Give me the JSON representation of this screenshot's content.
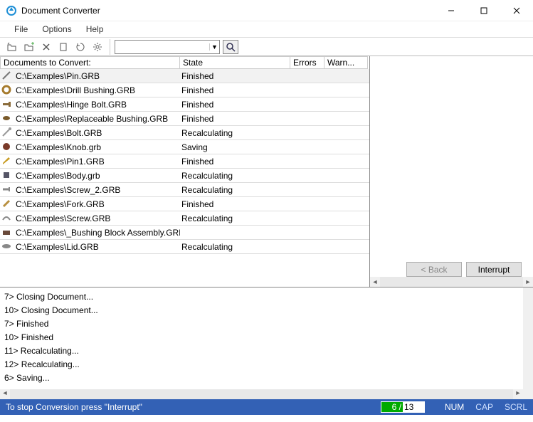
{
  "window": {
    "title": "Document Converter"
  },
  "menu": {
    "file": "File",
    "options": "Options",
    "help": "Help"
  },
  "toolbar": {
    "combo_value": ""
  },
  "grid": {
    "headers": {
      "documents": "Documents to Convert:",
      "state": "State",
      "errors": "Errors",
      "warnings": "Warn..."
    },
    "rows": [
      {
        "path": "C:\\Examples\\Pin.GRB",
        "state": "Finished",
        "icon": "pin",
        "selected": true
      },
      {
        "path": "C:\\Examples\\Drill Bushing.GRB",
        "state": "Finished",
        "icon": "ring"
      },
      {
        "path": "C:\\Examples\\Hinge Bolt.GRB",
        "state": "Finished",
        "icon": "bolt"
      },
      {
        "path": "C:\\Examples\\Replaceable Bushing.GRB",
        "state": "Finished",
        "icon": "bushing"
      },
      {
        "path": "C:\\Examples\\Bolt.GRB",
        "state": "Recalculating",
        "icon": "bolt2"
      },
      {
        "path": "C:\\Examples\\Knob.grb",
        "state": "Saving",
        "icon": "knob"
      },
      {
        "path": "C:\\Examples\\Pin1.GRB",
        "state": "Finished",
        "icon": "pin1"
      },
      {
        "path": "C:\\Examples\\Body.grb",
        "state": "Recalculating",
        "icon": "body"
      },
      {
        "path": "C:\\Examples\\Screw_2.GRB",
        "state": "Recalculating",
        "icon": "screw"
      },
      {
        "path": "C:\\Examples\\Fork.GRB",
        "state": "Finished",
        "icon": "fork"
      },
      {
        "path": "C:\\Examples\\Screw.GRB",
        "state": "Recalculating",
        "icon": "screw2"
      },
      {
        "path": "C:\\Examples\\_Bushing Block Assembly.GRB",
        "state": "",
        "icon": "asm"
      },
      {
        "path": "C:\\Examples\\Lid.GRB",
        "state": "Recalculating",
        "icon": "lid"
      }
    ]
  },
  "right": {
    "back": "< Back",
    "interrupt": "Interrupt"
  },
  "log": {
    "lines": [
      "7> Closing Document...",
      "10> Closing Document...",
      "7> Finished",
      "10> Finished",
      "11> Recalculating...",
      "12> Recalculating...",
      "6> Saving..."
    ]
  },
  "status": {
    "message": "To stop Conversion press \"Interrupt\"",
    "progress_done": "6 /",
    "progress_total": " 13",
    "num": "NUM",
    "cap": "CAP",
    "scrl": "SCRL"
  }
}
